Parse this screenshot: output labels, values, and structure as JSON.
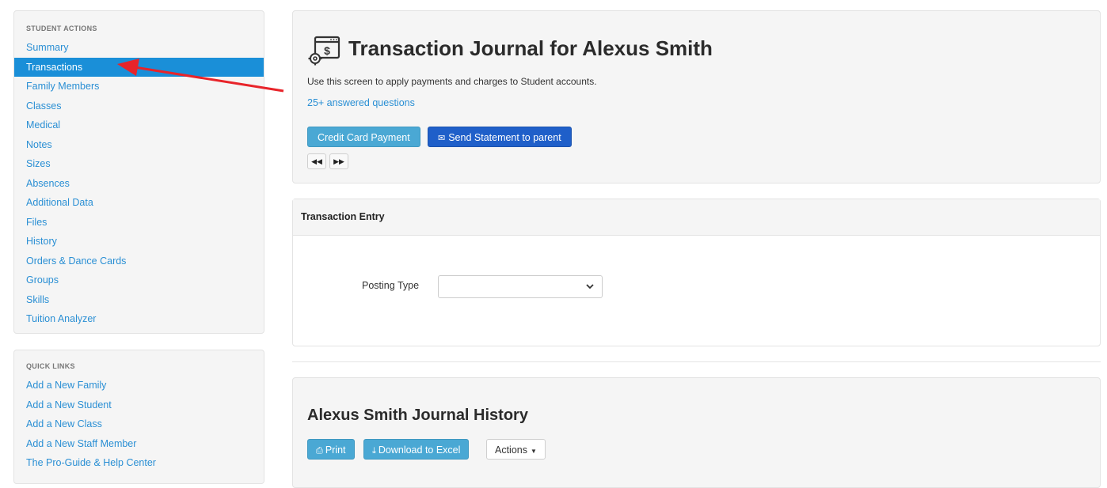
{
  "sidebar": {
    "actions_heading": "STUDENT ACTIONS",
    "actions": [
      {
        "label": "Summary"
      },
      {
        "label": "Transactions",
        "active": true
      },
      {
        "label": "Family Members"
      },
      {
        "label": "Classes"
      },
      {
        "label": "Medical"
      },
      {
        "label": "Notes"
      },
      {
        "label": "Sizes"
      },
      {
        "label": "Absences"
      },
      {
        "label": "Additional Data"
      },
      {
        "label": "Files"
      },
      {
        "label": "History"
      },
      {
        "label": "Orders & Dance Cards"
      },
      {
        "label": "Groups"
      },
      {
        "label": "Skills"
      },
      {
        "label": "Tuition Analyzer"
      }
    ],
    "quick_links_heading": "QUICK LINKS",
    "quick_links": [
      {
        "label": "Add a New Family"
      },
      {
        "label": "Add a New Student"
      },
      {
        "label": "Add a New Class"
      },
      {
        "label": "Add a New Staff Member"
      },
      {
        "label": "The Pro-Guide & Help Center"
      }
    ]
  },
  "header": {
    "title": "Transaction Journal for Alexus Smith",
    "description": "Use this screen to apply payments and charges to Student accounts.",
    "faq_link": "25+ answered questions",
    "credit_card_button": "Credit Card Payment",
    "send_statement_button": "Send Statement to parent",
    "icon": "transaction-settings-icon"
  },
  "entry": {
    "title": "Transaction Entry",
    "posting_type_label": "Posting Type",
    "posting_type_value": ""
  },
  "history": {
    "title": "Alexus Smith Journal History",
    "print_button": "Print",
    "excel_button": "Download to Excel",
    "actions_button": "Actions"
  },
  "colors": {
    "link": "#2a8fd4",
    "active_item": "#1a8fd8",
    "info_button": "#4aa8d4",
    "primary_button": "#1f5fc9",
    "annotation_arrow": "#e8242a"
  }
}
